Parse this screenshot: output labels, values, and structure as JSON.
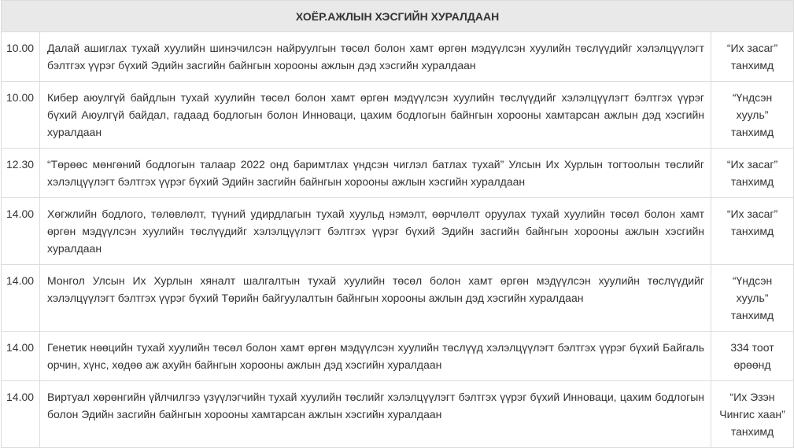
{
  "header": {
    "title": "ХОЁР.АЖЛЫН ХЭСГИЙН ХУРАЛДААН"
  },
  "rows": [
    {
      "time": "10.00",
      "description": "Далай ашиглах тухай хуулийн шинэчилсэн найруулгын төсөл болон хамт өргөн мэдүүлсэн хуулийн төслүүдийг хэлэлцүүлэгт бэлтгэх үүрэг бүхий Эдийн засгийн байнгын хорооны ажлын дэд хэсгийн хуралдаан",
      "location": [
        "“Их засаг”",
        "танхимд"
      ]
    },
    {
      "time": "10.00",
      "description": "Кибер аюулгүй байдлын тухай хуулийн төсөл болон хамт өргөн мэдүүлсэн хуулийн төслүүдийг хэлэлцүүлэгт бэлтгэх үүрэг бүхий Аюулгүй байдал, гадаад бодлогын болон Инноваци, цахим бодлогын байнгын хорооны хамтарсан ажлын дэд хэсгийн хуралдаан",
      "location": [
        "“Үндсэн",
        "хууль”",
        "танхимд"
      ]
    },
    {
      "time": "12.30",
      "description": "“Төрөөс мөнгөний бодлогын талаар 2022 онд баримтлах үндсэн чиглэл батлах тухай” Улсын Их Хурлын тогтоолын төслийг хэлэлцүүлэгт бэлтгэх үүрэг бүхий Эдийн засгийн байнгын хорооны ажлын хэсгийн хуралдаан",
      "location": [
        "“Их засаг”",
        "танхимд"
      ]
    },
    {
      "time": "14.00",
      "description": "Хөгжлийн бодлого, төлөвлөлт, түүний удирдлагын тухай хуульд нэмэлт, өөрчлөлт оруулах тухай хуулийн төсөл болон хамт өргөн мэдүүлсэн хуулийн төслүүдийг хэлэлцүүлэгт бэлтгэх үүрэг бүхий Эдийн засгийн байнгын хорооны ажлын хэсгийн хуралдаан",
      "location": [
        "“Их засаг”",
        "танхимд"
      ]
    },
    {
      "time": "14.00",
      "description": "Монгол Улсын Их Хурлын хяналт шалгалтын тухай хуулийн төсөл болон хамт өргөн мэдүүлсэн хуулийн төслүүдийг хэлэлцүүлэгт бэлтгэх үүрэг бүхий Төрийн байгуулалтын байнгын хорооны ажлын дэд хэсгийн хуралдаан",
      "location": [
        "“Үндсэн",
        "хууль”",
        "танхимд"
      ]
    },
    {
      "time": "14.00",
      "description": "Генетик нөөцийн тухай хуулийн төсөл болон хамт өргөн мэдүүлсэн хуулийн төслүүд хэлэлцүүлэгт бэлтгэх үүрэг бүхий Байгаль орчин, хүнс, хөдөө аж ахуйн байнгын хорооны ажлын дэд хэсгийн хуралдаан",
      "location": [
        "334 тоот",
        "өрөөнд"
      ]
    },
    {
      "time": "14.00",
      "description": "Виртуал хөрөнгийн үйлчилгээ үзүүлэгчийн тухай хуулийн төслийг хэлэлцүүлэгт бэлтгэх үүрэг бүхий Инноваци, цахим бодлогын болон Эдийн засгийн байнгын хорооны хамтарсан ажлын хэсгийн хуралдаан",
      "location": [
        "“Их Эзэн",
        "Чингис хаан”",
        "танхимд"
      ]
    }
  ]
}
